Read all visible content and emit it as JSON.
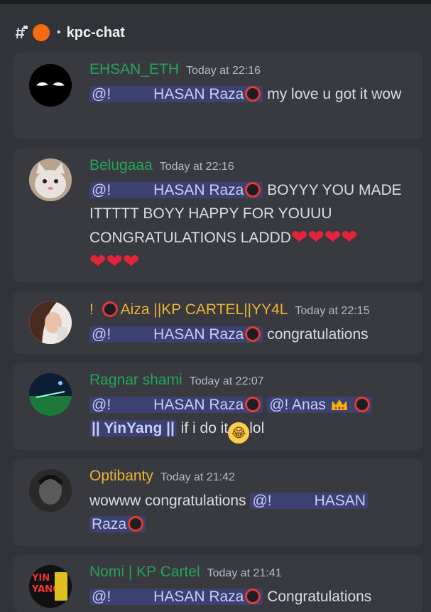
{
  "channel": {
    "name": "kpc-chat"
  },
  "messages": [
    {
      "author": "EHSAN_ETH",
      "author_color": "#23a55a",
      "time": "Today at 22:16",
      "mention": "HASAN Raza",
      "text": " my love u got it wow"
    },
    {
      "author": "Belugaaa",
      "author_color": "#23a55a",
      "time": "Today at 22:16",
      "mention": "HASAN Raza",
      "text": " BOYYY YOU MADE ITTTTT BOYY HAPPY FOR YOUUU CONGRATULATIONS LADDD"
    },
    {
      "author_prefix": "! ",
      "author": "Aiza ||KP CARTEL||YY4L",
      "author_color": "#f0b232",
      "time": "Today at 22:15",
      "mention": "HASAN Raza",
      "text": " congratulations"
    },
    {
      "author": "Ragnar shami",
      "author_color": "#23a55a",
      "time": "Today at 22:07",
      "mention": "HASAN Raza",
      "mention2": "@! Anas",
      "mention3": "|| YinYang ||",
      "text": " if i do it",
      "text2": "lol"
    },
    {
      "author": "Optibanty",
      "author_color": "#f0b232",
      "time": "Today at 21:42",
      "text": "wowww congratulations ",
      "mention_a": "HASAN",
      "mention_b": "Raza"
    },
    {
      "author": "Nomi | KP Cartel",
      "author_color": "#23a55a",
      "time": "Today at 21:41",
      "mention": "HASAN Raza",
      "text": " Congratulations"
    }
  ],
  "mention_prefix": "@!",
  "icons": [
    "hashtag-icon",
    "lock-icon",
    "orange-circle-icon",
    "red-ring-icon",
    "heart-icon",
    "crown-icon",
    "laughing-emoji-icon"
  ]
}
